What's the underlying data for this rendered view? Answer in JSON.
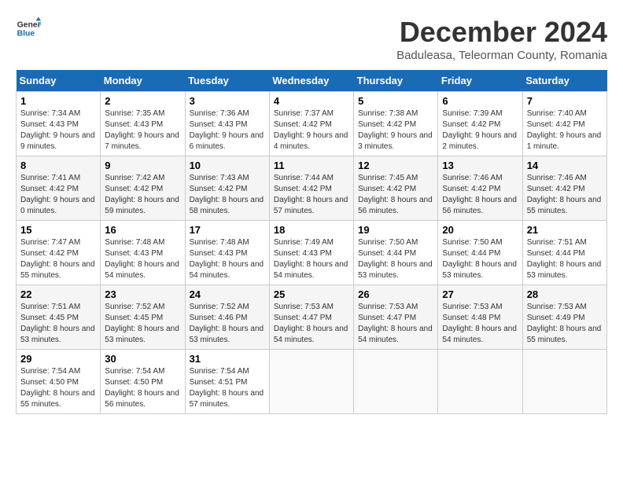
{
  "logo": {
    "line1": "General",
    "line2": "Blue"
  },
  "title": "December 2024",
  "location": "Baduleasa, Teleorman County, Romania",
  "days_header": [
    "Sunday",
    "Monday",
    "Tuesday",
    "Wednesday",
    "Thursday",
    "Friday",
    "Saturday"
  ],
  "weeks": [
    [
      {
        "num": "1",
        "rise": "7:34 AM",
        "set": "4:43 PM",
        "daylight": "9 hours and 9 minutes."
      },
      {
        "num": "2",
        "rise": "7:35 AM",
        "set": "4:43 PM",
        "daylight": "9 hours and 7 minutes."
      },
      {
        "num": "3",
        "rise": "7:36 AM",
        "set": "4:43 PM",
        "daylight": "9 hours and 6 minutes."
      },
      {
        "num": "4",
        "rise": "7:37 AM",
        "set": "4:42 PM",
        "daylight": "9 hours and 4 minutes."
      },
      {
        "num": "5",
        "rise": "7:38 AM",
        "set": "4:42 PM",
        "daylight": "9 hours and 3 minutes."
      },
      {
        "num": "6",
        "rise": "7:39 AM",
        "set": "4:42 PM",
        "daylight": "9 hours and 2 minutes."
      },
      {
        "num": "7",
        "rise": "7:40 AM",
        "set": "4:42 PM",
        "daylight": "9 hours and 1 minute."
      }
    ],
    [
      {
        "num": "8",
        "rise": "7:41 AM",
        "set": "4:42 PM",
        "daylight": "9 hours and 0 minutes."
      },
      {
        "num": "9",
        "rise": "7:42 AM",
        "set": "4:42 PM",
        "daylight": "8 hours and 59 minutes."
      },
      {
        "num": "10",
        "rise": "7:43 AM",
        "set": "4:42 PM",
        "daylight": "8 hours and 58 minutes."
      },
      {
        "num": "11",
        "rise": "7:44 AM",
        "set": "4:42 PM",
        "daylight": "8 hours and 57 minutes."
      },
      {
        "num": "12",
        "rise": "7:45 AM",
        "set": "4:42 PM",
        "daylight": "8 hours and 56 minutes."
      },
      {
        "num": "13",
        "rise": "7:46 AM",
        "set": "4:42 PM",
        "daylight": "8 hours and 56 minutes."
      },
      {
        "num": "14",
        "rise": "7:46 AM",
        "set": "4:42 PM",
        "daylight": "8 hours and 55 minutes."
      }
    ],
    [
      {
        "num": "15",
        "rise": "7:47 AM",
        "set": "4:42 PM",
        "daylight": "8 hours and 55 minutes."
      },
      {
        "num": "16",
        "rise": "7:48 AM",
        "set": "4:43 PM",
        "daylight": "8 hours and 54 minutes."
      },
      {
        "num": "17",
        "rise": "7:48 AM",
        "set": "4:43 PM",
        "daylight": "8 hours and 54 minutes."
      },
      {
        "num": "18",
        "rise": "7:49 AM",
        "set": "4:43 PM",
        "daylight": "8 hours and 54 minutes."
      },
      {
        "num": "19",
        "rise": "7:50 AM",
        "set": "4:44 PM",
        "daylight": "8 hours and 53 minutes."
      },
      {
        "num": "20",
        "rise": "7:50 AM",
        "set": "4:44 PM",
        "daylight": "8 hours and 53 minutes."
      },
      {
        "num": "21",
        "rise": "7:51 AM",
        "set": "4:44 PM",
        "daylight": "8 hours and 53 minutes."
      }
    ],
    [
      {
        "num": "22",
        "rise": "7:51 AM",
        "set": "4:45 PM",
        "daylight": "8 hours and 53 minutes."
      },
      {
        "num": "23",
        "rise": "7:52 AM",
        "set": "4:45 PM",
        "daylight": "8 hours and 53 minutes."
      },
      {
        "num": "24",
        "rise": "7:52 AM",
        "set": "4:46 PM",
        "daylight": "8 hours and 53 minutes."
      },
      {
        "num": "25",
        "rise": "7:53 AM",
        "set": "4:47 PM",
        "daylight": "8 hours and 54 minutes."
      },
      {
        "num": "26",
        "rise": "7:53 AM",
        "set": "4:47 PM",
        "daylight": "8 hours and 54 minutes."
      },
      {
        "num": "27",
        "rise": "7:53 AM",
        "set": "4:48 PM",
        "daylight": "8 hours and 54 minutes."
      },
      {
        "num": "28",
        "rise": "7:53 AM",
        "set": "4:49 PM",
        "daylight": "8 hours and 55 minutes."
      }
    ],
    [
      {
        "num": "29",
        "rise": "7:54 AM",
        "set": "4:50 PM",
        "daylight": "8 hours and 55 minutes."
      },
      {
        "num": "30",
        "rise": "7:54 AM",
        "set": "4:50 PM",
        "daylight": "8 hours and 56 minutes."
      },
      {
        "num": "31",
        "rise": "7:54 AM",
        "set": "4:51 PM",
        "daylight": "8 hours and 57 minutes."
      },
      null,
      null,
      null,
      null
    ]
  ]
}
